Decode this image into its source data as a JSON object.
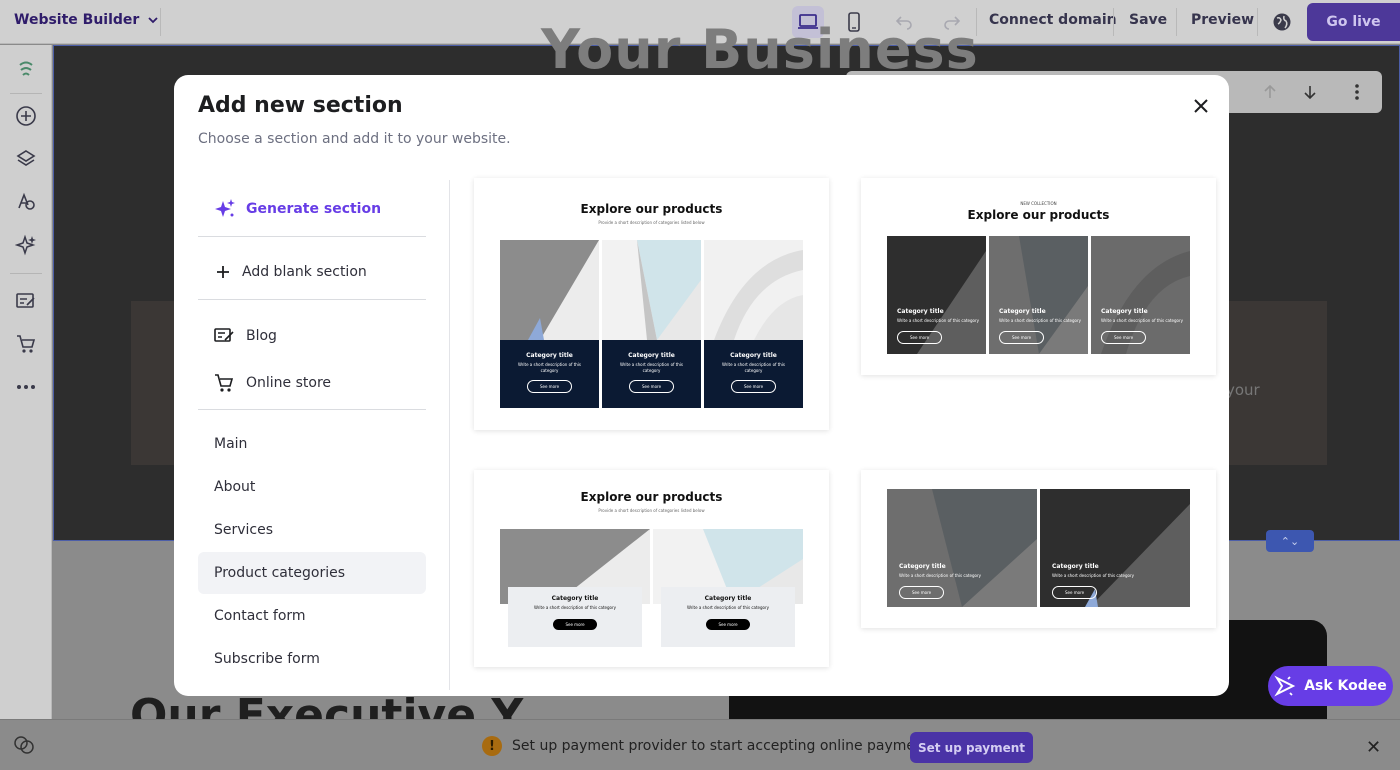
{
  "topbar": {
    "brand": "Website Builder",
    "connect_domain": "Connect domain",
    "save": "Save",
    "preview": "Preview",
    "go_live": "Go live"
  },
  "background": {
    "heading": "Your Business",
    "snippet": "your",
    "bigtext": "Our Executive Y..."
  },
  "modal": {
    "title": "Add new section",
    "subtitle": "Choose a section and add it to your website.",
    "menu": {
      "generate": "Generate section",
      "blank": "Add blank section",
      "blog": "Blog",
      "store": "Online store",
      "main": "Main",
      "about": "About",
      "services": "Services",
      "product_categories": "Product categories",
      "contact_form": "Contact form",
      "subscribe_form": "Subscribe form"
    },
    "cards": {
      "c1": {
        "title": "Explore our products",
        "desc": "Provide a short description of categories listed below",
        "tile_title": "Category title",
        "tile_desc": "Write a short description of this category",
        "tile_btn": "See more"
      },
      "c2": {
        "kicker": "NEW COLLECTION",
        "title": "Explore our products",
        "tile_title": "Category title",
        "tile_desc": "Write a short description of this category",
        "tile_btn": "See more"
      },
      "c3": {
        "title": "Explore our products",
        "desc": "Provide a short description of categories listed below",
        "tile_title": "Category title",
        "tile_desc": "Write a short description of this category",
        "tile_btn": "See more"
      },
      "c4": {
        "tile_title": "Category title",
        "tile_desc": "Write a short description of this category",
        "tile_btn": "See more"
      }
    }
  },
  "bottom": {
    "notice": "Set up payment provider to start accepting online payments",
    "setup_button": "Set up payment"
  },
  "ask_kodee": "Ask Kodee",
  "colors": {
    "accent": "#673de6",
    "navy": "#0b1a33"
  }
}
